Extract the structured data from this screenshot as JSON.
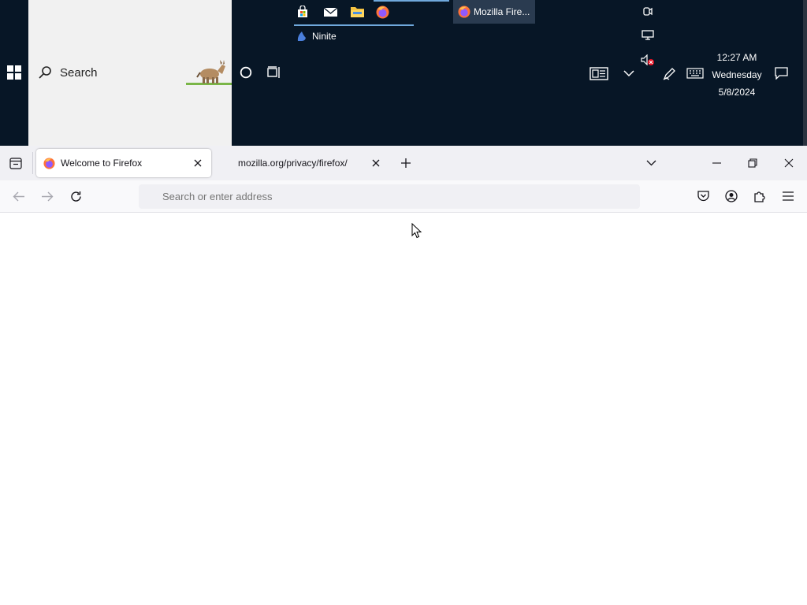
{
  "taskbar": {
    "search_label": "Search",
    "apps": [
      "store-icon",
      "mail-icon",
      "file-explorer-icon",
      "firefox-icon"
    ],
    "ninite_label": "Ninite",
    "firefox_button_label": "Mozilla Fire...",
    "clock": {
      "time": "12:27 AM",
      "day": "Wednesday",
      "date": "5/8/2024"
    }
  },
  "firefox": {
    "tabs": [
      {
        "title": "Welcome to Firefox",
        "active": true
      },
      {
        "title": "mozilla.org/privacy/firefox/",
        "active": false
      }
    ],
    "address_placeholder": "Search or enter address"
  },
  "colors": {
    "taskbar_bg": "#071626",
    "accent": "#6fa8dc"
  }
}
